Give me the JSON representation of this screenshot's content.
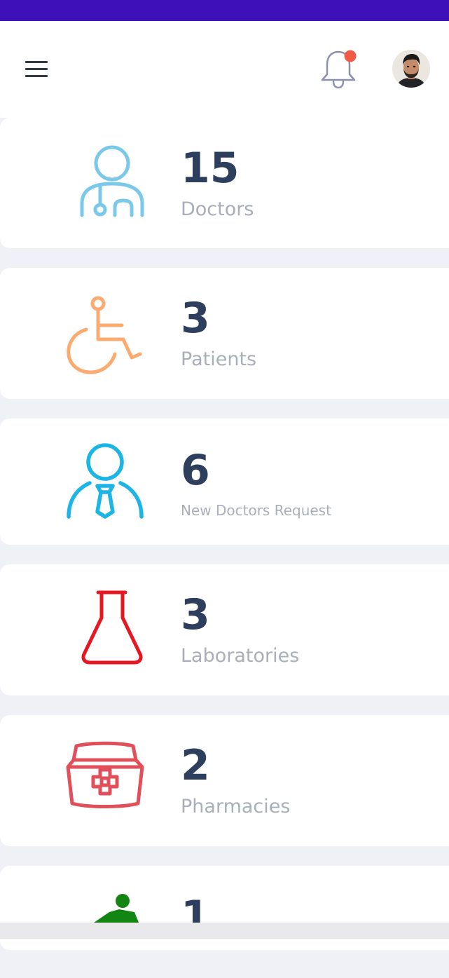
{
  "header": {
    "menu_icon": "menu-icon",
    "notification_icon": "bell-icon",
    "notification_badge_color": "#f15a47",
    "avatar": "user-avatar"
  },
  "stats": [
    {
      "count": "15",
      "label": "Doctors",
      "icon": "doctor-icon",
      "color": "#7ac8ea"
    },
    {
      "count": "3",
      "label": "Patients",
      "icon": "wheelchair-icon",
      "color": "#fbab72"
    },
    {
      "count": "6",
      "label": "New Doctors Request",
      "icon": "new-doctor-icon",
      "color": "#1db5e5"
    },
    {
      "count": "3",
      "label": "Laboratories",
      "icon": "flask-icon",
      "color": "#e51722"
    },
    {
      "count": "2",
      "label": "Pharmacies",
      "icon": "medical-kit-icon",
      "color": "#e04f5a"
    },
    {
      "count": "1",
      "label": "",
      "icon": "person-icon",
      "color": "#128512"
    }
  ]
}
